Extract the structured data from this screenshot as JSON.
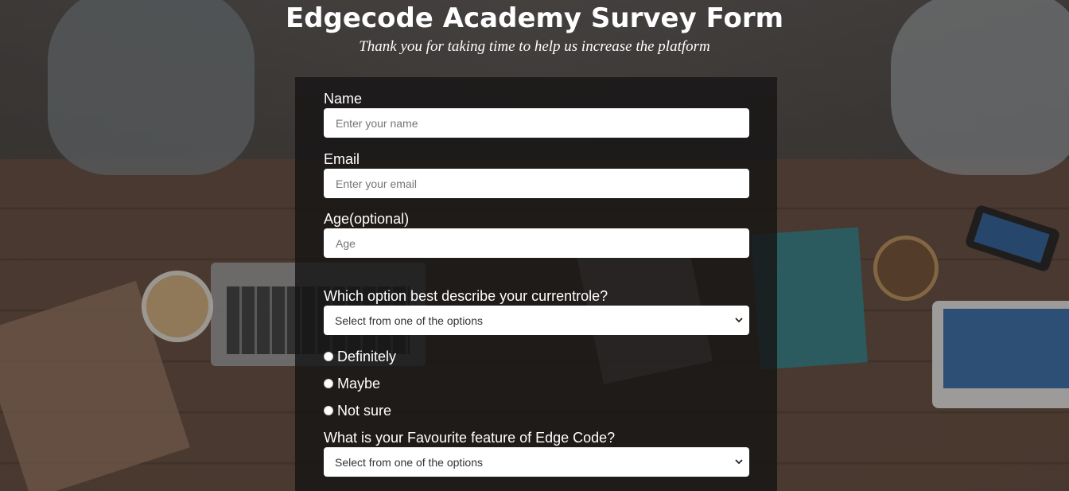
{
  "header": {
    "title": "Edgecode Academy Survey Form",
    "subtitle": "Thank you for taking time to help us increase the platform"
  },
  "form": {
    "name": {
      "label": "Name",
      "placeholder": "Enter your name",
      "value": ""
    },
    "email": {
      "label": "Email",
      "placeholder": "Enter your email",
      "value": ""
    },
    "age": {
      "label": "Age(optional)",
      "placeholder": "Age",
      "value": ""
    },
    "role": {
      "label": "Which option best describe your currentrole?",
      "selected": "Select from one of the options"
    },
    "recommend": {
      "options": [
        {
          "label": "Definitely",
          "checked": false
        },
        {
          "label": "Maybe",
          "checked": false
        },
        {
          "label": "Not sure",
          "checked": false
        }
      ]
    },
    "feature": {
      "label": "What is your Favourite feature of Edge Code?",
      "selected": "Select from one of the options"
    }
  },
  "icons": {
    "select_chevron": "chevron-down-icon",
    "radio": "radio-button-icon"
  },
  "colors": {
    "panel_background": "#161515",
    "text": "#ffffff",
    "input_background": "#ffffff"
  }
}
